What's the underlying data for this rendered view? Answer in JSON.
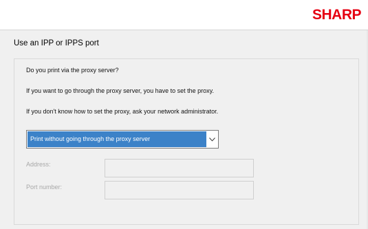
{
  "brand": {
    "logo_text": "SHARP",
    "logo_color": "#e60012"
  },
  "page": {
    "title": "Use an IPP or IPPS port"
  },
  "proxy": {
    "question": "Do you print via the proxy server?",
    "info_line1": "If you want to go through the proxy server, you have to set the proxy.",
    "info_line2": "If you don't know how to set the proxy, ask your network administrator.",
    "selected_option": "Print without going through the proxy server",
    "selection_color": "#3c82c8"
  },
  "fields": {
    "address_label": "Address:",
    "address_value": "",
    "port_label": "Port number:",
    "port_value": ""
  }
}
